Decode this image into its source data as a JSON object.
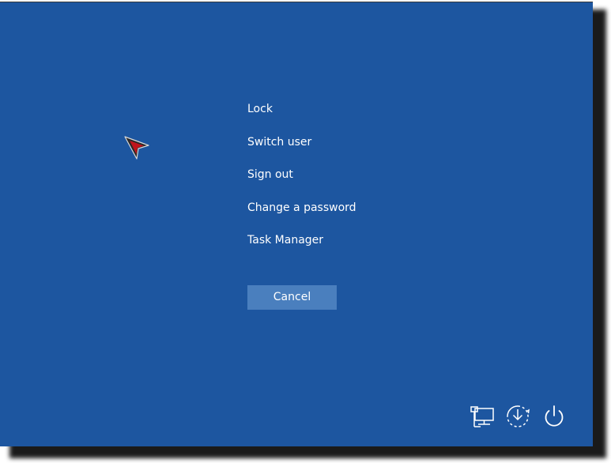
{
  "menu": {
    "items": [
      {
        "label": "Lock"
      },
      {
        "label": "Switch user"
      },
      {
        "label": "Sign out"
      },
      {
        "label": "Change a password"
      },
      {
        "label": "Task Manager"
      }
    ]
  },
  "cancel": {
    "label": "Cancel"
  },
  "tray": {
    "icons": [
      "network-icon",
      "ease-of-access-icon",
      "power-icon"
    ]
  },
  "colors": {
    "background": "#1d56a0",
    "button": "#4a7fbe",
    "text": "#ffffff",
    "cursor_accent": "#c0141c"
  }
}
